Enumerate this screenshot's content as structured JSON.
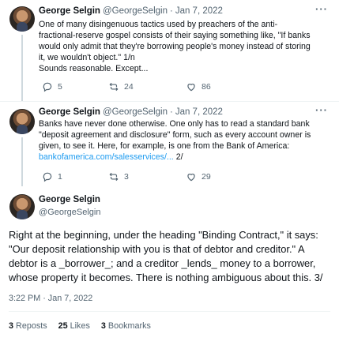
{
  "tweets": [
    {
      "name": "George Selgin",
      "handle": "@GeorgeSelgin",
      "dot": "·",
      "date": "Jan 7, 2022",
      "lines": [
        "One of many disingenuous tactics used by preachers of the anti-",
        "fractional-reserve gospel consists of their saying something like, \"If banks",
        "would only admit that they're  borrowing people's money instead of storing",
        "it, we wouldn't object.\" 1/n",
        "Sounds reasonable. Except..."
      ],
      "replies": "5",
      "reposts": "24",
      "likes": "86"
    },
    {
      "name": "George Selgin",
      "handle": "@GeorgeSelgin",
      "dot": "·",
      "date": "Jan 7, 2022",
      "lines": [
        "Banks have never done otherwise. One only has to read a standard bank",
        "\"deposit agreement and disclosure\" form, such as every account owner is",
        "given, to see it. Here, for example, is one from the Bank of America:"
      ],
      "link_text": "bankofamerica.com/salesservices/...",
      "link_suffix": " 2/",
      "replies": "1",
      "reposts": "3",
      "likes": "29"
    }
  ],
  "main": {
    "name": "George Selgin",
    "handle": "@GeorgeSelgin",
    "lines": [
      "Right at the beginning, under the heading \"Binding Contract,\" it says:",
      "\"Our deposit relationship with you is that of debtor and creditor.\" A",
      "debtor is a _borrower_; and a creditor _lends_ money to a borrower,",
      "whose property it becomes. There is nothing ambiguous about this. 3/"
    ],
    "timestamp": "3:22 PM · Jan 7, 2022",
    "stats": {
      "reposts_count": "3",
      "reposts_label": "Reposts",
      "likes_count": "25",
      "likes_label": "Likes",
      "bookmarks_count": "3",
      "bookmarks_label": "Bookmarks"
    }
  },
  "icons": {
    "more": "more-icon",
    "reply": "reply-icon",
    "repost": "repost-icon",
    "like": "like-icon"
  },
  "colors": {
    "link": "#1d9bf0",
    "text": "#0f1419",
    "muted": "#536471"
  }
}
